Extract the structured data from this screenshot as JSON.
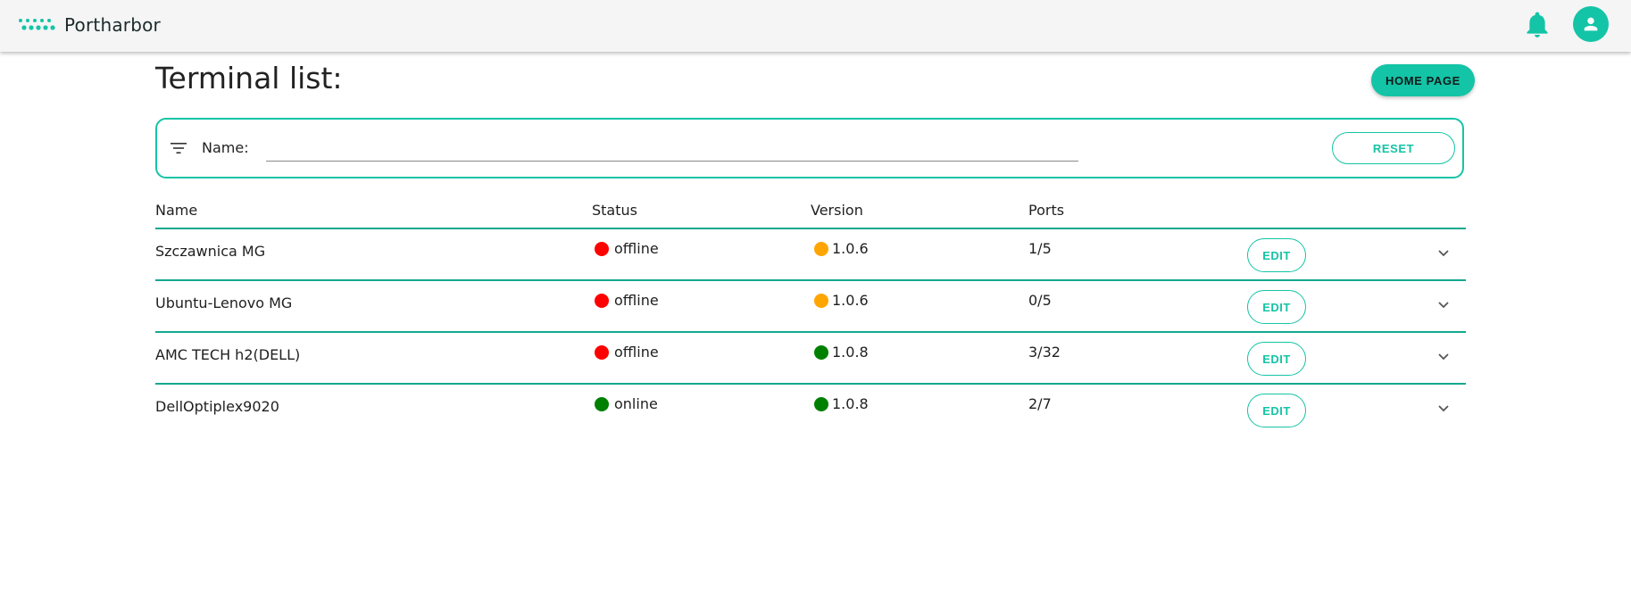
{
  "app": {
    "name": "Portharbor",
    "brand_color": "#14c4a6"
  },
  "header": {
    "logo_icon": "dots-logo-icon",
    "notification_icon": "bell-icon",
    "account_icon": "user-icon"
  },
  "page": {
    "title": "Terminal list:",
    "home_button_label": "HOME PAGE"
  },
  "filter": {
    "icon": "filter-icon",
    "name_label": "Name:",
    "name_value": "",
    "name_placeholder": "",
    "reset_label": "RESET"
  },
  "table": {
    "columns": {
      "name": "Name",
      "status": "Status",
      "version": "Version",
      "ports": "Ports"
    },
    "rows": [
      {
        "name": "Szczawnica MG",
        "status": "offline",
        "status_color": "#ff0000",
        "version": "1.0.6",
        "version_color": "#ffa500",
        "ports": "1/5",
        "edit_label": "EDIT"
      },
      {
        "name": "Ubuntu-Lenovo MG",
        "status": "offline",
        "status_color": "#ff0000",
        "version": "1.0.6",
        "version_color": "#ffa500",
        "ports": "0/5",
        "edit_label": "EDIT"
      },
      {
        "name": "AMC TECH h2(DELL)",
        "status": "offline",
        "status_color": "#ff0000",
        "version": "1.0.8",
        "version_color": "#008000",
        "ports": "3/32",
        "edit_label": "EDIT"
      },
      {
        "name": "DellOptiplex9020",
        "status": "online",
        "status_color": "#008000",
        "version": "1.0.8",
        "version_color": "#008000",
        "ports": "2/7",
        "edit_label": "EDIT"
      }
    ]
  }
}
